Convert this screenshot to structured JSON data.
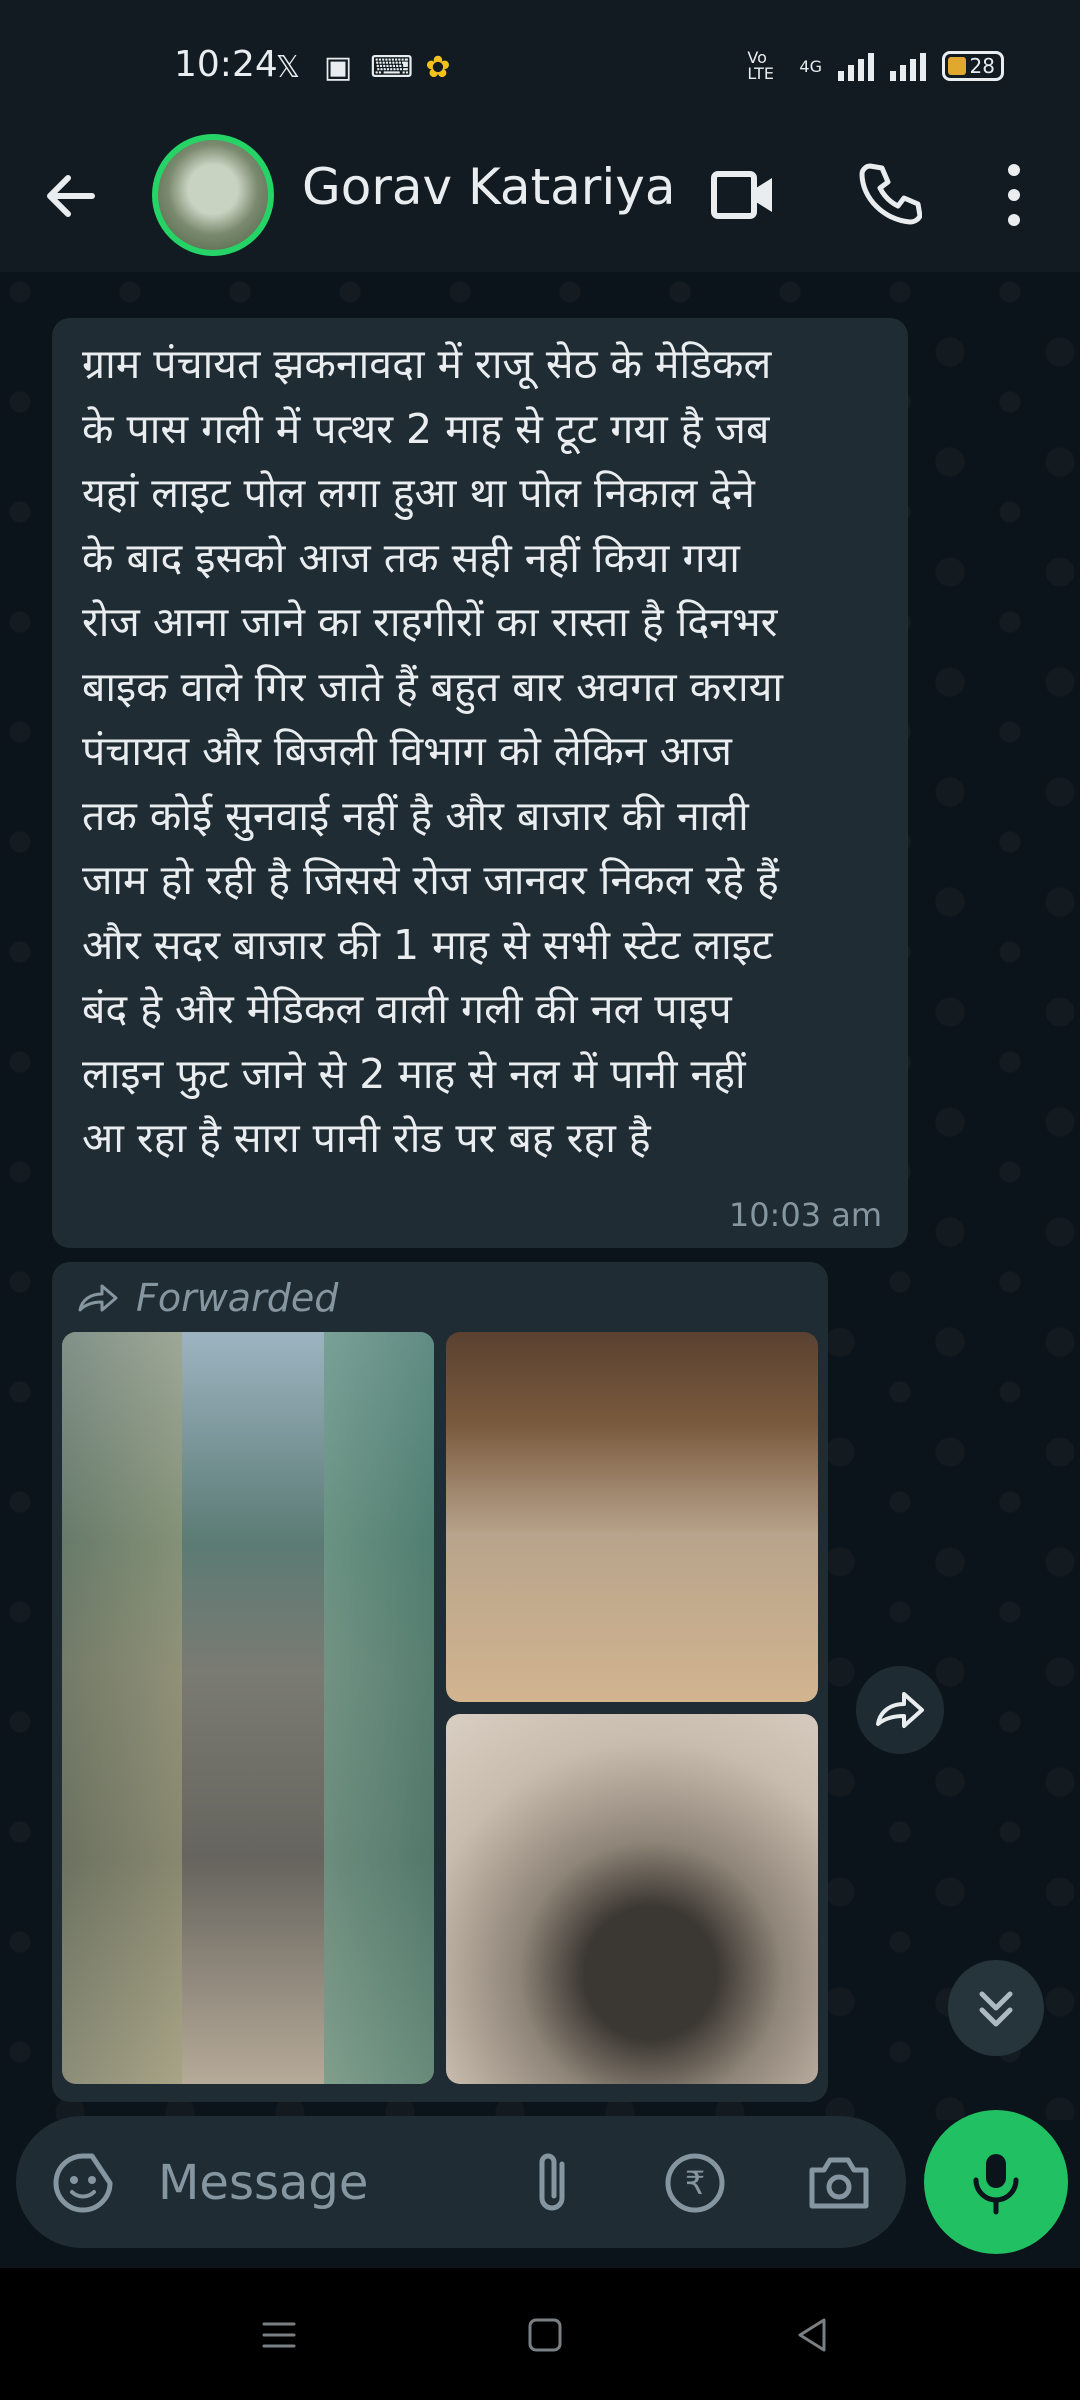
{
  "status_bar": {
    "time": "10:24",
    "notification_icons": [
      "x-icon",
      "image-icon",
      "keyboard-icon",
      "sun-app-icon"
    ],
    "network_label": "4G",
    "volte_label": "Vo LTE",
    "battery_level": "28"
  },
  "header": {
    "contact_name": "Gorav Katariya"
  },
  "messages": {
    "text_message": {
      "text": "ग्राम पंचायत झकनावदा में राजू सेठ के मेडिकल\nके पास गली में पत्थर 2 माह से टूट गया है जब\nयहां लाइट  पोल लगा हुआ था पोल निकाल देने\nके बाद इसको आज तक सही नहीं किया गया\nरोज आना जाने  का राहगीरों का रास्ता है दिनभर\nबाइक वाले गिर जाते हैं बहुत बार अवगत कराया\nपंचायत और बिजली विभाग को लेकिन आज\nतक कोई सुनवाई नहीं है और बाजार की नाली\nजाम हो रही है जिससे रोज जानवर निकल रहे हैं\nऔर सदर बाजार की  1 माह से सभी स्टेट लाइट\nबंद हे और मेडिकल वाली  गली की नल पाइप\nलाइन फुट जाने से 2 माह से नल में पानी नहीं\nआ रहा है सारा पानी रोड पर बह रहा है",
      "time": "10:03 am"
    },
    "media_message": {
      "forwarded_label": "Forwarded",
      "photo_count": 3
    }
  },
  "input": {
    "placeholder": "Message"
  },
  "colors": {
    "background": "#0b141a",
    "bubble": "#202c33",
    "accent": "#21c063",
    "meta_text": "#8696a0"
  }
}
